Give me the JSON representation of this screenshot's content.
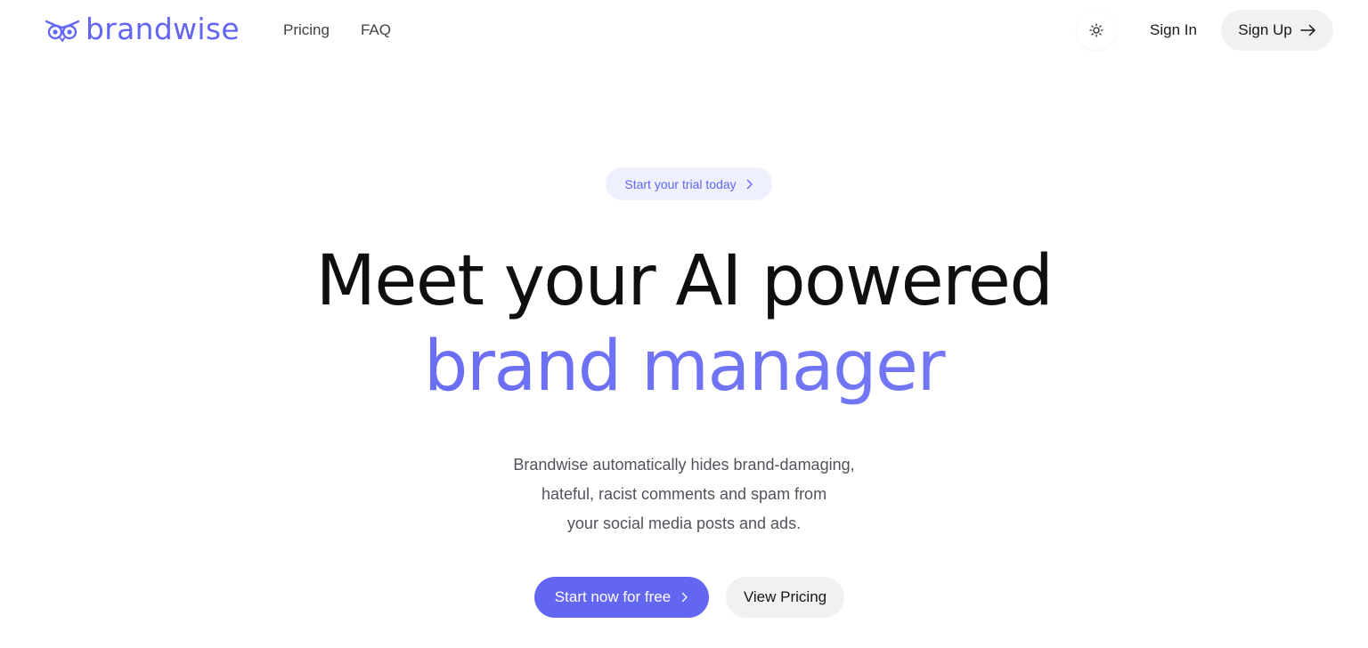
{
  "brand": {
    "name": "brandwise",
    "icon": "owl-logo-icon",
    "color": "#6366f1"
  },
  "nav": {
    "items": [
      {
        "label": "Pricing"
      },
      {
        "label": "FAQ"
      }
    ]
  },
  "header": {
    "theme_toggle_icon": "sun-icon",
    "signin_label": "Sign In",
    "signup_label": "Sign Up",
    "signup_icon": "arrow-right-icon"
  },
  "hero": {
    "badge_label": "Start your trial today",
    "badge_icon": "chevron-right-icon",
    "headline_line1": "Meet your AI powered",
    "headline_line2": "brand manager",
    "subtitle_lines": [
      "Brandwise automatically hides brand-damaging,",
      "hateful, racist comments and spam from",
      "your social media posts and ads."
    ],
    "cta_primary_label": "Start now for free",
    "cta_primary_icon": "chevron-right-icon",
    "cta_secondary_label": "View Pricing"
  },
  "colors": {
    "accent": "#6366f1",
    "text": "#0f0f10",
    "muted": "#52525b",
    "button_secondary_bg": "#f1f1f3",
    "badge_bg": "#eef0fd"
  }
}
